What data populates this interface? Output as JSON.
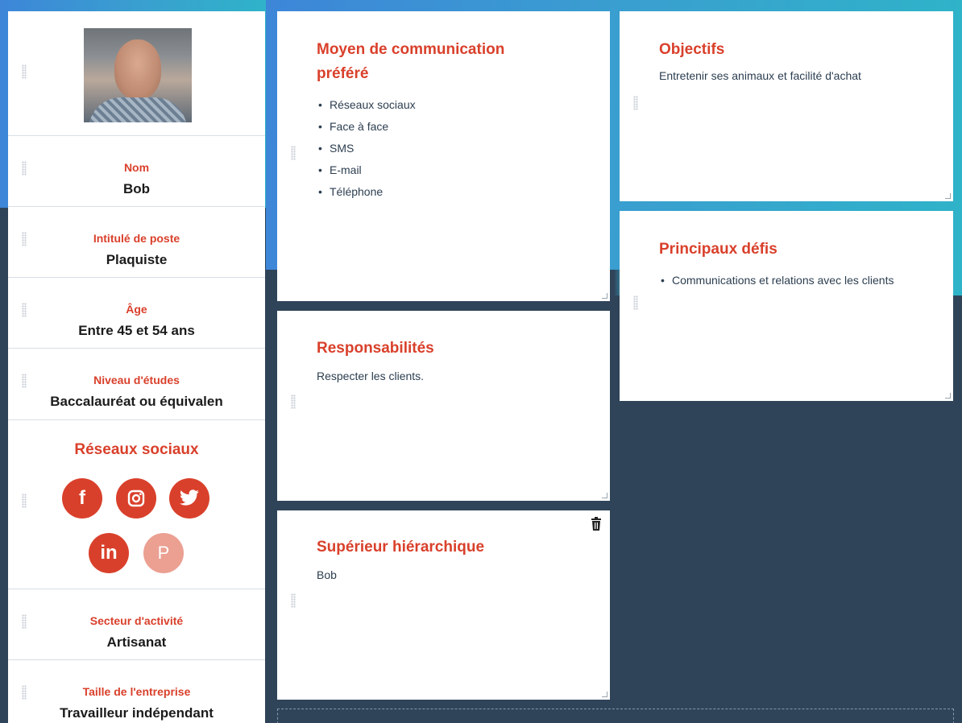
{
  "profile": {
    "name_label": "Nom",
    "name_value": "Bob",
    "job_label": "Intitulé de poste",
    "job_value": "Plaquiste",
    "age_label": "Âge",
    "age_value": "Entre 45 et 54 ans",
    "education_label": "Niveau d'études",
    "education_value": "Baccalauréat ou équivalen",
    "social_title": "Réseaux sociaux",
    "social_icons": [
      "facebook-icon",
      "instagram-icon",
      "twitter-icon",
      "linkedin-icon",
      "pinterest-icon"
    ],
    "sector_label": "Secteur d'activité",
    "sector_value": "Artisanat",
    "company_size_label": "Taille de l'entreprise",
    "company_size_value": "Travailleur indépendant"
  },
  "communication": {
    "title_line1": "Moyen de communication",
    "title_line2": "préféré",
    "items": [
      "Réseaux sociaux",
      "Face à face",
      "SMS",
      "E-mail",
      "Téléphone"
    ]
  },
  "objectives": {
    "title": "Objectifs",
    "text": "Entretenir ses animaux et facilité d'achat"
  },
  "challenges": {
    "title": "Principaux défis",
    "items": [
      "Communications et relations avec les clients"
    ]
  },
  "responsibilities": {
    "title": "Responsabilités",
    "text": "Respecter les clients."
  },
  "manager": {
    "title": "Supérieur hiérarchique",
    "text": "Bob"
  },
  "colors": {
    "accent": "#d9402b",
    "accent_faded": "#eba092",
    "background_dark": "#2f4459",
    "gradient_blue": "#3d86d8",
    "gradient_teal": "#2fb3c9"
  }
}
